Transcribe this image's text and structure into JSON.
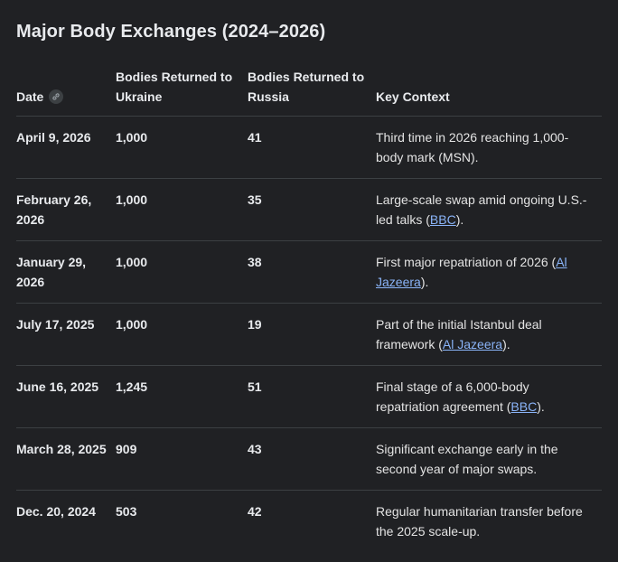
{
  "title": "Major Body Exchanges (2024–2026)",
  "headers": {
    "date": "Date",
    "ukraine": "Bodies Returned to Ukraine",
    "russia": "Bodies Returned to Russia",
    "context": "Key Context"
  },
  "rows": [
    {
      "date": "April 9, 2026",
      "ukraine": "1,000",
      "russia": "41",
      "context": "Third time in 2026 reaching 1,000-body mark (MSN).",
      "source": "",
      "after": ""
    },
    {
      "date": "February 26, 2026",
      "ukraine": "1,000",
      "russia": "35",
      "context": "Large-scale swap amid ongoing U.S.-led talks (",
      "source": "BBC",
      "after": ")."
    },
    {
      "date": "January 29, 2026",
      "ukraine": "1,000",
      "russia": "38",
      "context": "First major repatriation of 2026 (",
      "source": "Al Jazeera",
      "after": ")."
    },
    {
      "date": "July 17, 2025",
      "ukraine": "1,000",
      "russia": "19",
      "context": "Part of the initial Istanbul deal framework (",
      "source": "Al Jazeera",
      "after": ")."
    },
    {
      "date": "June 16, 2025",
      "ukraine": "1,245",
      "russia": "51",
      "context": "Final stage of a 6,000-body repatriation agreement (",
      "source": "BBC",
      "after": ")."
    },
    {
      "date": "March 28, 2025",
      "ukraine": "909",
      "russia": "43",
      "context": "Significant exchange early in the second year of major swaps.",
      "source": "",
      "after": ""
    },
    {
      "date": "Dec. 20, 2024",
      "ukraine": "503",
      "russia": "42",
      "context": "Regular humanitarian transfer before the 2025 scale-up.",
      "source": "",
      "after": ""
    }
  ],
  "colors": {
    "background": "#202124",
    "link": "#8ab4f8",
    "border": "#3c4043"
  }
}
